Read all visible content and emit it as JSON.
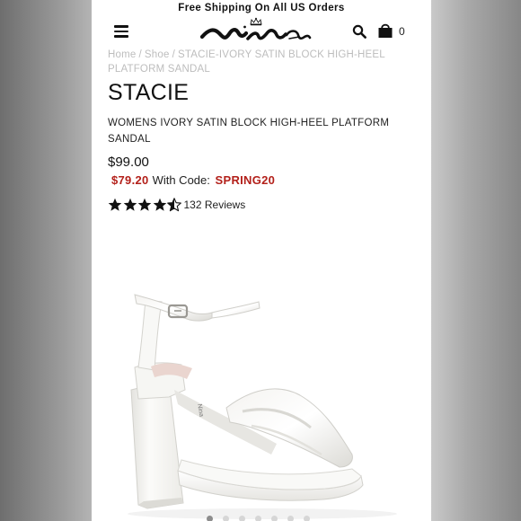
{
  "promo_bar": {
    "text": "Free Shipping On All US Orders"
  },
  "header": {
    "menu_icon": "hamburger-menu-icon",
    "logo": "Nina",
    "search_icon": "search-icon",
    "cart_icon": "shopping-bag-icon",
    "cart_count": "0"
  },
  "breadcrumb": {
    "items": [
      "Home",
      "Shoe",
      "STACIE-IVORY SATIN BLOCK HIGH-HEEL PLATFORM SANDAL"
    ],
    "separator": "/"
  },
  "product": {
    "name": "STACIE",
    "description": "WOMENS IVORY SATIN BLOCK HIGH-HEEL PLATFORM SANDAL",
    "price": "$99.00",
    "promo_price": "$79.20",
    "promo_text": "With Code:",
    "promo_code": "SPRING20",
    "rating_value": 4.5,
    "rating_max": 5,
    "reviews_label": "132 Reviews"
  },
  "gallery": {
    "image_count": 7,
    "active_index": 0
  },
  "colors": {
    "promo_red": "#b3201a",
    "breadcrumb_gray": "#bdbdbd",
    "star": "#111111"
  }
}
